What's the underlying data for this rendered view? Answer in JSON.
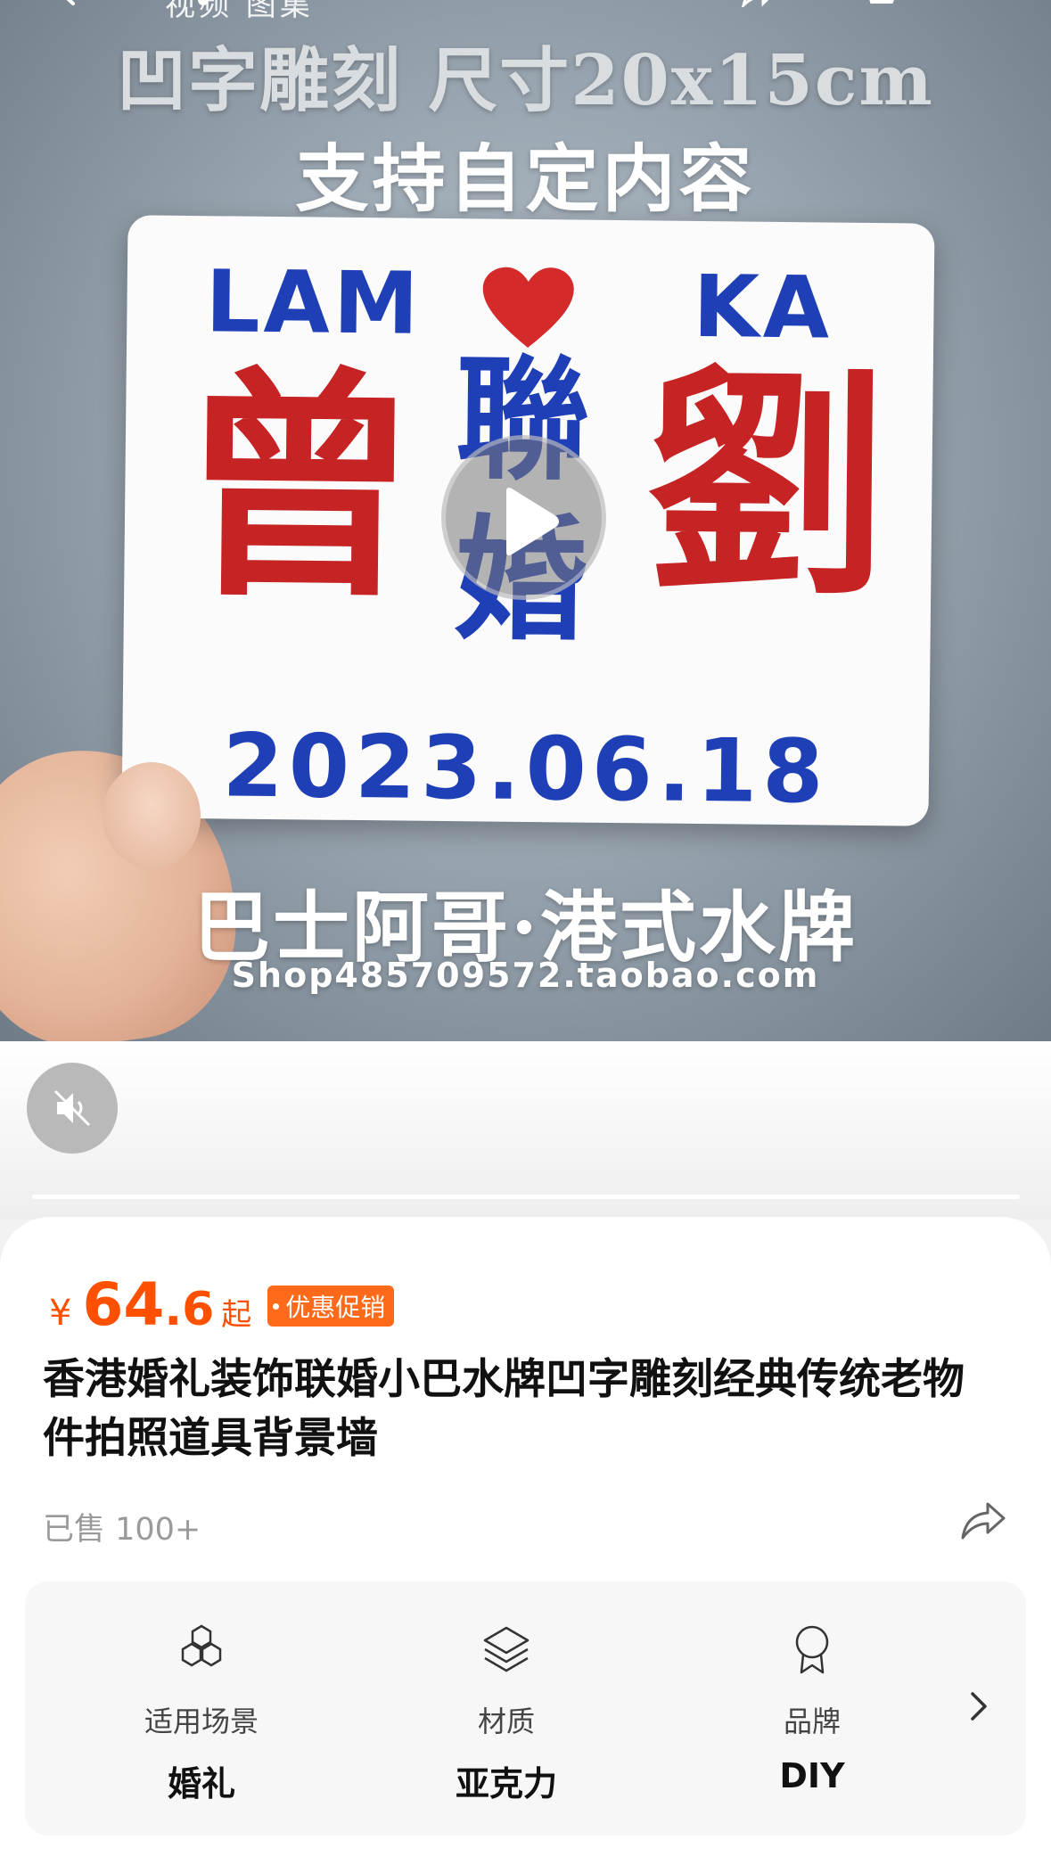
{
  "topbar": {
    "tabs_text": "视频  图集",
    "icons": [
      "back-icon",
      "share-icon",
      "cart-icon"
    ]
  },
  "video": {
    "overlay_line1": "凹字雕刻 尺寸20x15cm",
    "overlay_line2": "支持自定内容",
    "plate": {
      "left_name": "LAM",
      "right_name": "KA",
      "big_left": "曾",
      "mid_top": "聯",
      "mid_bottom": "婚",
      "big_right": "劉",
      "date": "2023.06.18"
    },
    "overlay_line3": "巴士阿哥·港式水牌",
    "overlay_line4": "Shop485709572.taobao.com",
    "play_icon": "play-icon",
    "mute_icon": "mute-icon"
  },
  "product": {
    "currency_symbol": "¥",
    "price_int": "64",
    "price_dec": ".6",
    "price_suffix": "起",
    "promo_badge": "优惠促销",
    "title": "香港婚礼装饰联婚小巴水牌凹字雕刻经典传统老物件拍照道具背景墙",
    "sold": "已售 100+",
    "accent_color": "#ff5000"
  },
  "attributes": [
    {
      "icon": "hexagon-cluster-icon",
      "label": "适用场景",
      "value": "婚礼"
    },
    {
      "icon": "layers-icon",
      "label": "材质",
      "value": "亚克力"
    },
    {
      "icon": "badge-icon",
      "label": "品牌",
      "value": "DIY"
    }
  ]
}
